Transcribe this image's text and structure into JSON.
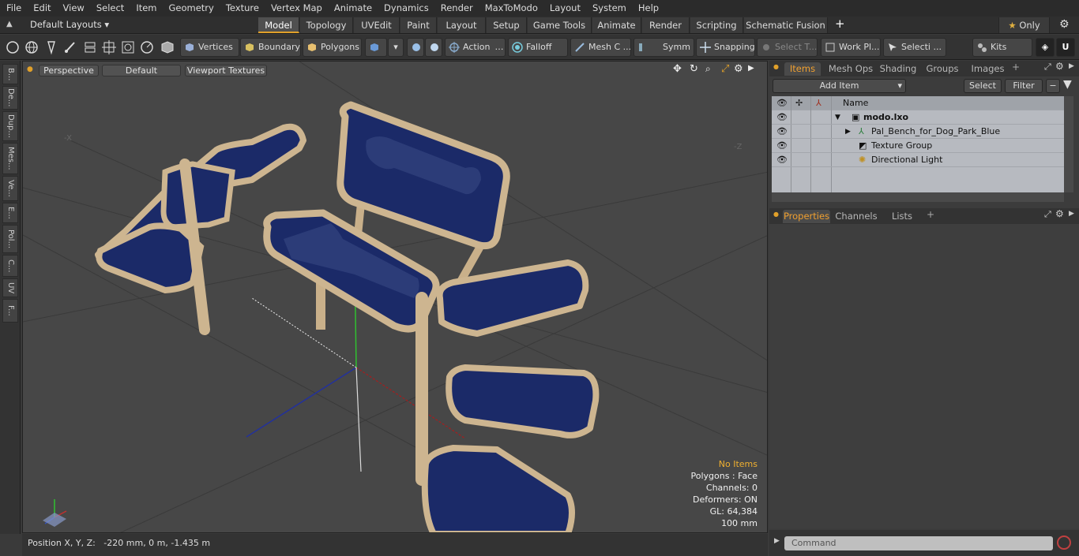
{
  "menu": [
    "File",
    "Edit",
    "View",
    "Select",
    "Item",
    "Geometry",
    "Texture",
    "Vertex Map",
    "Animate",
    "Dynamics",
    "Render",
    "MaxToModo",
    "Layout",
    "System",
    "Help"
  ],
  "layout_selector": "Default Layouts",
  "layout_tabs": [
    "Model",
    "Topology",
    "UVEdit",
    "Paint",
    "Layout",
    "Setup",
    "Game Tools",
    "Animate",
    "Render",
    "Scripting",
    "Schematic Fusion"
  ],
  "only_label": "Only",
  "toolbar": {
    "vertices": "Vertices",
    "boundary": "Boundary",
    "polygons": "Polygons",
    "action": "Action",
    "falloff": "Falloff",
    "mesh": "Mesh C ...",
    "symm": "Symm ...",
    "snapping": "Snapping",
    "select_t": "Select T...",
    "work_pl": "Work Pl...",
    "selecti": "Selecti ...",
    "kits": "Kits"
  },
  "left_tabs": [
    "B...",
    "De...",
    "Dup...",
    "Mes...",
    "Ve...",
    "E...",
    "Pol...",
    "C...",
    "UV",
    "F..."
  ],
  "viewport": {
    "view": "Perspective",
    "shading": "Default",
    "textures": "Viewport Textures",
    "axis_neg_x": "-X",
    "axis_neg_z": "-Z"
  },
  "info": {
    "items": "No Items",
    "polygons": "Polygons : Face",
    "channels": "Channels: 0",
    "deformers": "Deformers: ON",
    "gl": "GL: 64,384",
    "grid": "100 mm"
  },
  "status": "Position X, Y, Z:   -220 mm, 0 m, -1.435 m",
  "right_tabs": [
    "Items",
    "Mesh Ops",
    "Shading",
    "Groups",
    "Images"
  ],
  "add_item": "Add Item",
  "select_btn": "Select",
  "filter_btn": "Filter",
  "name_col": "Name",
  "scene": {
    "root": "modo.lxo",
    "children": [
      "Pal_Bench_for_Dog_Park_Blue",
      "Texture Group",
      "Directional Light"
    ]
  },
  "prop_tabs": [
    "Properties",
    "Channels",
    "Lists"
  ],
  "command_placeholder": "Command",
  "colors": {
    "accent": "#e0a02a",
    "seat": "#1b2a68",
    "frame": "#cdb590"
  }
}
